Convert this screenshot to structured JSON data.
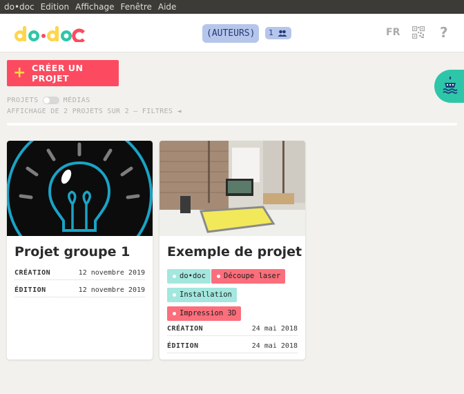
{
  "menubar": {
    "items": [
      "do•doc",
      "Edition",
      "Affichage",
      "Fenêtre",
      "Aide"
    ]
  },
  "header": {
    "authors_label": "(AUTEURS)",
    "authors_count": "1",
    "lang": "FR"
  },
  "actions": {
    "create_label": "CRÉER UN PROJET"
  },
  "filters": {
    "projects_label": "PROJETS",
    "medias_label": "MÉDIAS",
    "summary": "AFFICHAGE DE 2 PROJETS SUR 2 — FILTRES ◄"
  },
  "projects": [
    {
      "title": "Projet groupe 1",
      "created_label": "CRÉATION",
      "created": "12 novembre 2019",
      "edited_label": "ÉDITION",
      "edited": "12 novembre 2019"
    },
    {
      "title": "Exemple de projet",
      "tags": [
        "do•doc",
        "Découpe laser",
        "Installation",
        "Impression 3D"
      ],
      "created_label": "CRÉATION",
      "created": "24 mai 2018",
      "edited_label": "ÉDITION",
      "edited": "24 mai 2018"
    }
  ],
  "colors": {
    "accent_red": "#fc4b60",
    "accent_yellow": "#ffd54a",
    "author_blue": "#b6c5ea",
    "tag_teal": "#a3e7de",
    "tag_pink": "#fb6e7b",
    "fab_teal": "#2ec6a8"
  },
  "icons": [
    "plus-icon",
    "users-icon",
    "qr-code-icon",
    "help-icon",
    "boat-icon",
    "lightbulb-illustration"
  ]
}
